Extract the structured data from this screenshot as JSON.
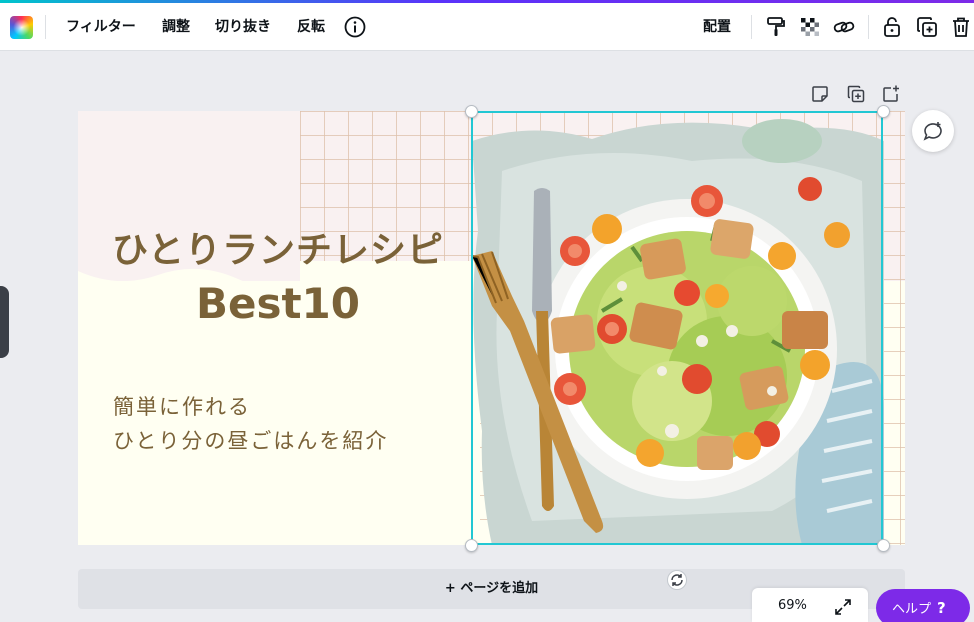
{
  "toolbar": {
    "filter_label": "フィルター",
    "adjust_label": "調整",
    "crop_label": "切り抜き",
    "flip_label": "反転",
    "arrange_label": "配置"
  },
  "design": {
    "title_line1": "ひとりランチレシピ",
    "title_line2": "Best10",
    "subtitle_line1": "簡単に作れる",
    "subtitle_line2": "ひとり分の昼ごはんを紹介"
  },
  "canvas": {
    "add_page_label": "+ ページを追加"
  },
  "footer": {
    "zoom": "69%",
    "help_label": "ヘルプ",
    "help_mark": "?"
  },
  "colors": {
    "accent": "#7d2ae8",
    "selection": "#22c7d3",
    "title_brown": "#7a6238"
  },
  "icons": [
    "color-picker-icon",
    "info-icon",
    "paint-format-icon",
    "transparency-icon",
    "link-icon",
    "lock-icon",
    "duplicate-icon",
    "trash-icon",
    "note-icon",
    "add-page-icon",
    "comment-icon",
    "rotate-icon",
    "expand-icon"
  ]
}
